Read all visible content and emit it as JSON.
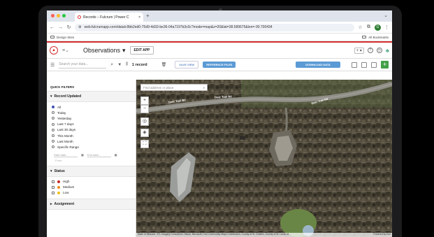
{
  "browser": {
    "tab_title": "Records – Fulcrum | Power C",
    "new_tab": "+",
    "url": "web.fulcrumapp.com/data/c9bb2ed0-75d9-4d33-be36-04a7197b3c0c?mode=map&z=20&lat=38.589675&lon=-90.700434",
    "bookmark": "Design Sites",
    "all_bookmarks": "All Bookmarks",
    "profile_initial": "G"
  },
  "app": {
    "title": "Observations",
    "edit_app": "EDIT APP"
  },
  "toolbar": {
    "search_placeholder": "Search your data...",
    "record_count": "1 record",
    "save_view": "SAVE VIEW",
    "reference_files": "REFERENCE FILES",
    "download_data": "DOWNLOAD DATA"
  },
  "sidebar": {
    "quick_filters": "QUICK FILTERS",
    "record_updated": {
      "label": "Record Updated",
      "options": [
        "All",
        "Today",
        "Yesterday",
        "Last 7 days",
        "Last 30 days",
        "This Month",
        "Last Month",
        "Specific Range"
      ],
      "selected": "All",
      "start_placeholder": "Start date...",
      "end_placeholder": "End date...",
      "from_label": "From"
    },
    "status": {
      "label": "Status",
      "options": [
        {
          "label": "High",
          "color": "#c62828"
        },
        {
          "label": "Medium",
          "color": "#ef8c1a"
        },
        {
          "label": "Low",
          "color": "#f2c21b"
        }
      ]
    },
    "assignment": "Assignment"
  },
  "map": {
    "search_placeholder": "Find address or place",
    "road_name": "Deer Trail Rd",
    "attribution": "State of Missouri, STL Imagery Consortium, Maxar, Microsoft | Esri Community Maps Contributors, County of St. Charles, County of St. Louis, M...",
    "powered_by": "Powered by Esri"
  },
  "colors": {
    "brand_red": "#d32f2f",
    "accent_blue": "#5b9bd5",
    "add_green": "#43a047"
  }
}
